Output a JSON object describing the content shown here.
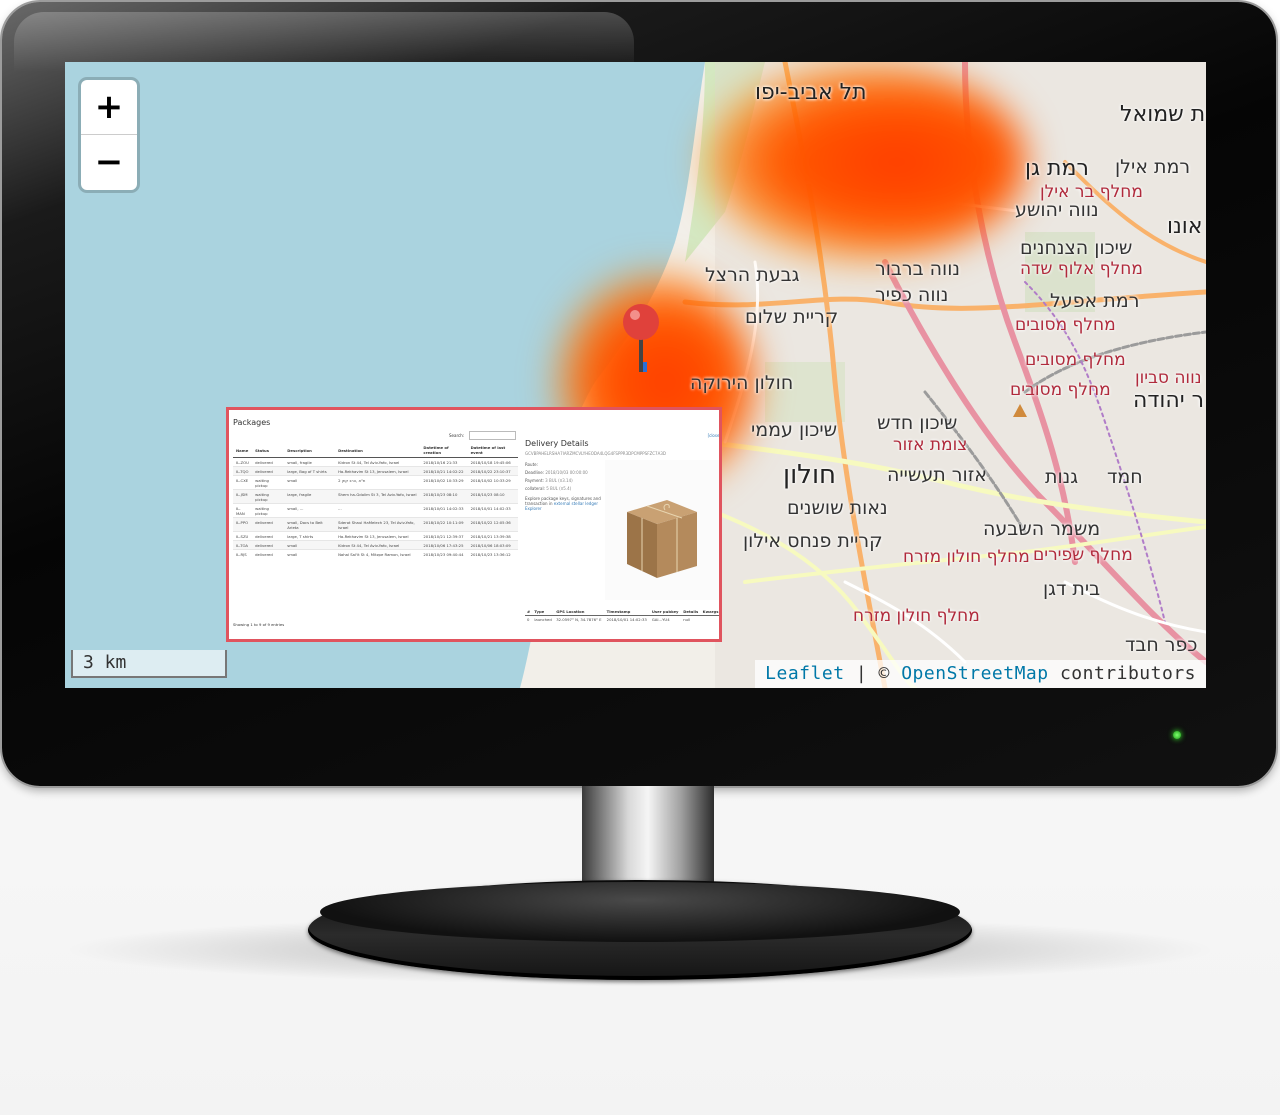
{
  "map": {
    "zoom_in": "+",
    "zoom_out": "−",
    "scale": "3 km",
    "attribution": {
      "leaflet": "Leaflet",
      "sep": " | © ",
      "osm": "OpenStreetMap",
      "contributors": " contributors"
    },
    "places": [
      {
        "text": "תל אביב-יפו",
        "cls": "big"
      },
      {
        "text": "רמת אילן",
        "cls": "mid"
      },
      {
        "text": "רמת גן",
        "cls": "big"
      },
      {
        "text": "מחלף בר אילן",
        "cls": "red"
      },
      {
        "text": "נווה יהושע",
        "cls": "mid"
      },
      {
        "text": "שיכון הצנחנים",
        "cls": "mid"
      },
      {
        "text": "מחלף אלוף שדה",
        "cls": "red"
      },
      {
        "text": "גבעת הרצל",
        "cls": "mid"
      },
      {
        "text": "נווה ברבור",
        "cls": "mid"
      },
      {
        "text": "נווה כפיר",
        "cls": "mid"
      },
      {
        "text": "רמת אפעל",
        "cls": "mid"
      },
      {
        "text": "קריית שלום",
        "cls": "mid"
      },
      {
        "text": "מחלף מסובים",
        "cls": "red"
      },
      {
        "text": "מחלף מסובים",
        "cls": "red"
      },
      {
        "text": "מחלף מסובים",
        "cls": "red"
      },
      {
        "text": "נווה סביון",
        "cls": "red"
      },
      {
        "text": "חולון הירוקה",
        "cls": "mid"
      },
      {
        "text": "שיכון חדש",
        "cls": "mid"
      },
      {
        "text": "צומת אזור",
        "cls": "red"
      },
      {
        "text": "שיכון עממי",
        "cls": "mid"
      },
      {
        "text": "חולון",
        "cls": "big"
      },
      {
        "text": "אזור תעשייה",
        "cls": "mid"
      },
      {
        "text": "גנות",
        "cls": "mid"
      },
      {
        "text": "חמד",
        "cls": "mid"
      },
      {
        "text": "נאות שושנים",
        "cls": "mid"
      },
      {
        "text": "קריית פנחס אילון",
        "cls": "mid"
      },
      {
        "text": "משמר השבעה",
        "cls": "mid"
      },
      {
        "text": "מחלף חולון מזרח",
        "cls": "red"
      },
      {
        "text": "מחלף שפירים",
        "cls": "red"
      },
      {
        "text": "בית דגן",
        "cls": "mid"
      },
      {
        "text": "מחלף חולון מזרח",
        "cls": "red"
      },
      {
        "text": "כפר חבד",
        "cls": "mid"
      },
      {
        "text": "אונו",
        "cls": "big"
      },
      {
        "text": "ת שמואל",
        "cls": "big"
      },
      {
        "text": "ר יהודה",
        "cls": "big"
      }
    ]
  },
  "panel": {
    "title": "Packages",
    "search_label": "Search:",
    "columns": [
      "Name",
      "Status",
      "Description",
      "Destination",
      "Datetime of creation",
      "Datetime of last event"
    ],
    "rows": [
      [
        "IL-ZOU",
        "delivered",
        "small, fragile",
        "Kidron St 44, Tel Aviv-Yafo, Israel",
        "2018/10/16 21:33",
        "2018/10/18 19:45:06"
      ],
      [
        "IL-TQO",
        "delivered",
        "large, Bag of T shirts",
        "Ha-Rekhavim St 13, Jerusalem, Israel",
        "2018/10/21 14:02:22",
        "2018/10/22 23:10:37"
      ],
      [
        "IL-CXE",
        "waiting pickup",
        "small",
        "ת\"א ,הרב קוק 2",
        "2018/10/02 10:33:29",
        "2018/10/02 10:33:29"
      ],
      [
        "IL-JSM",
        "waiting pickup",
        "large, fragile",
        "Shem ha-Gdolim St 3, Tel Aviv-Yafo, Israel",
        "2018/10/23 08:10",
        "2018/10/23 08:10"
      ],
      [
        "IL-MAN",
        "waiting pickup",
        "small, ...",
        "...",
        "2018/10/01 14:02:33",
        "2018/10/01 14:02:33"
      ],
      [
        "IL-PPO",
        "delivered",
        "small, Docs to Beit Arieta",
        "Sderot Shaul HaMelech 23, Tel Aviv-Yafo, Israel",
        "2018/10/22 10:11:09",
        "2018/10/22 12:05:36"
      ],
      [
        "IL-SZU",
        "delivered",
        "large, T shirts",
        "Ha-Rekhavim St 13, Jerusalem, Israel",
        "2018/10/21 12:39:37",
        "2018/10/21 13:39:38"
      ],
      [
        "IL-TOA",
        "delivered",
        "small",
        "Kidron St 44, Tel Aviv-Yafo, Israel",
        "2018/10/06 17:43:25",
        "2018/10/06 18:03:09"
      ],
      [
        "IL-RJS",
        "delivered",
        "small",
        "Nahal Sal'it St 4, Mitzpe Ramon, Israel",
        "2018/10/23 09:40:44",
        "2018/10/23 13:36:12"
      ]
    ],
    "showing": "Showing 1 to 9 of 9 entries",
    "detail": {
      "title": "Delivery Details",
      "close": "[close]",
      "address": "GCVBPAHELRSHA7IARZMCVLYHEODA4LQG4FSPPR3DPCMPPSFZC7A3D",
      "route_label": "Route:",
      "deadline_label": "Deadline:",
      "deadline": "2018/10/03 00:00:00",
      "payment_label": "Payment:",
      "payment": "3 BUL (¤3.14)",
      "collateral_label": "collateral:",
      "collateral": "5 BUL (¤5.4)",
      "explore": "Explore package keys, signatures and transaction in",
      "explore_link": "external stellar ledger Explorer",
      "event_columns": [
        "#",
        "Type",
        "GPS Location",
        "Timestamp",
        "User pubkey",
        "Details",
        "Kwargs"
      ],
      "events": [
        [
          "0",
          "launched",
          "32.0597° N, 34.7876° E",
          "2018/10/01 14:02:33",
          "GAI...YU4",
          "null",
          ""
        ]
      ]
    }
  }
}
